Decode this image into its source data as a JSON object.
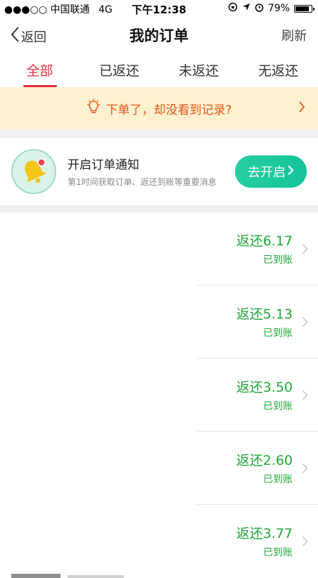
{
  "status_bar": {
    "carrier": "●●●○○ 中国联通",
    "network": "4G",
    "time": "下午12:38",
    "battery": "79%"
  },
  "nav": {
    "back_label": "返回",
    "title": "我的订单",
    "refresh_label": "刷新"
  },
  "tabs": [
    {
      "label": "全部",
      "active": true
    },
    {
      "label": "已返还",
      "active": false
    },
    {
      "label": "未返还",
      "active": false
    },
    {
      "label": "无返还",
      "active": false
    }
  ],
  "notice": {
    "text": "下单了，却没看到记录?"
  },
  "order_notify": {
    "title": "开启订单通知",
    "subtitle": "第1时间获取订单、返还到账等重要消息",
    "button_label": "去开启"
  },
  "orders": [
    {
      "amount": "返还6.17",
      "status": "已到账"
    },
    {
      "amount": "返还5.13",
      "status": "已到账"
    },
    {
      "amount": "返还3.50",
      "status": "已到账"
    },
    {
      "amount": "返还2.60",
      "status": "已到账"
    },
    {
      "amount": "返还3.77",
      "status": "已到账"
    }
  ],
  "colors": {
    "accent_red": "#e0303e",
    "notice_orange": "#e9561a",
    "notice_bg": "#fdf1d0",
    "green": "#20a83a",
    "button_green": "#1cc99d"
  }
}
